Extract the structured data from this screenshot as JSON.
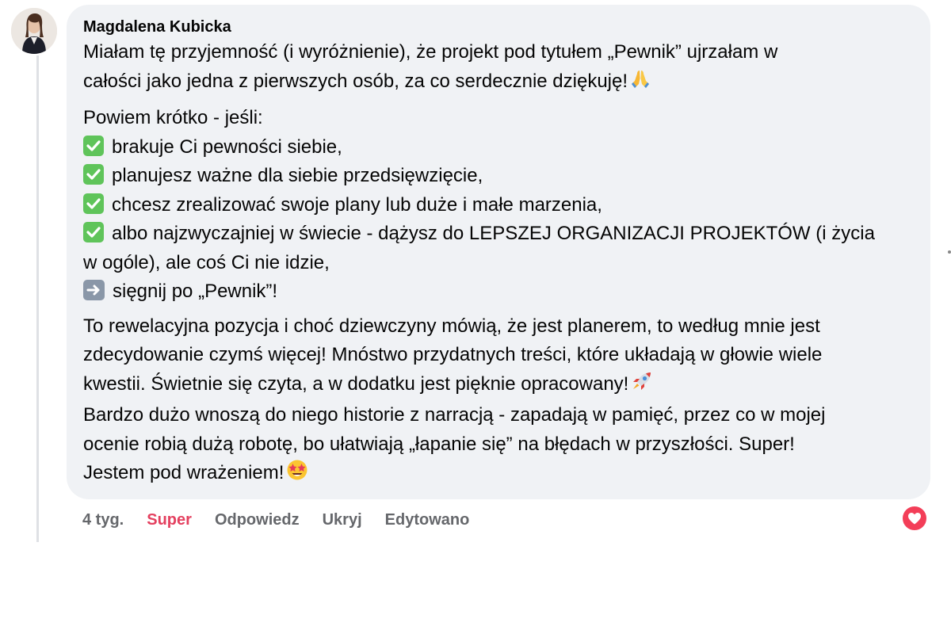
{
  "comment": {
    "author": "Magdalena Kubicka",
    "paragraph1": [
      "Miałam tę przyjemność (i wyróżnienie), że projekt pod tytułem „Pewnik” ujrzałam w",
      "całości jako jedna z pierwszych osób, za co serdecznie dziękuję!"
    ],
    "intro": "Powiem krótko - jeśli:",
    "checklist": [
      "brakuje Ci pewności siebie,",
      "planujesz ważne dla siebie przedsięwzięcie,",
      "chcesz zrealizować swoje plany lub duże i małe marzenia,",
      "albo najzwyczajniej w świecie - dążysz do LEPSZEJ ORGANIZACJI PROJEKTÓW (i życia"
    ],
    "checklist_continuation": "w ogóle), ale coś Ci nie idzie,",
    "arrow_line": "sięgnij po „Pewnik”!",
    "paragraph3": [
      "To rewelacyjna pozycja i choć dziewczyny mówią, że jest planerem, to według mnie jest",
      "zdecydowanie czymś więcej! Mnóstwo przydatnych treści, które układają w głowie wiele",
      "kwestii. Świetnie się czyta, a w dodatku jest pięknie opracowany!",
      "Bardzo dużo wnoszą do niego historie z narracją - zapadają w pamięć, przez co w mojej",
      "ocenie robią dużą robotę, bo ułatwiają „łapanie się” na błędach w przyszłości. Super!",
      "Jestem pod wrażeniem!"
    ],
    "emojis": {
      "thanks": "folded-hands",
      "rocket": "rocket",
      "starstruck": "star-struck",
      "check": "check-mark-button",
      "arrow": "right-arrow"
    }
  },
  "actions": {
    "time": "4 tyg.",
    "reaction": "Super",
    "reply": "Odpowiedz",
    "hide": "Ukryj",
    "edited": "Edytowano"
  },
  "colors": {
    "bubble": "#f0f2f5",
    "reaction_text": "#e4405f",
    "heart_badge": "#f33e58",
    "check_green": "#5fc45a"
  }
}
